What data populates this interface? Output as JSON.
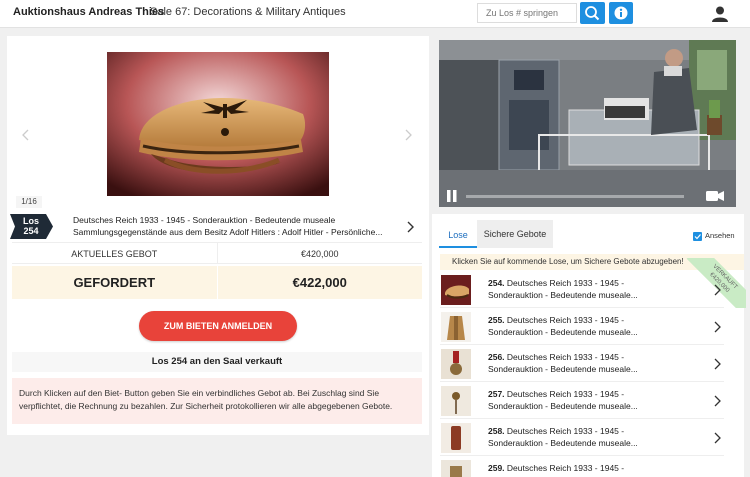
{
  "header": {
    "brand": "Auktionshaus Andreas Thies",
    "sale": "Sale 67: Decorations & Military Antiques",
    "jump_placeholder": "Zu Los # springen"
  },
  "lot": {
    "counter": "1/16",
    "badge_line1": "Los",
    "badge_line2": "254",
    "desc_line1": "Deutsches Reich 1933 - 1945 - Sonderauktion - Bedeutende museale",
    "desc_line2": "Sammlungsgegenstände aus dem Besitz Adolf Hitlers : Adolf Hitler - Persönliche...",
    "current_bid_label": "AKTUELLES GEBOT",
    "current_bid_value": "€420,000",
    "asking_label": "GEFORDERT",
    "asking_value": "€422,000",
    "register_button": "ZUM BIETEN ANMELDEN",
    "sold_status": "Los 254 an den Saal verkauft",
    "notice": "Durch Klicken auf den Biet- Button geben Sie ein verbindliches Gebot ab. Bei Zuschlag sind Sie verpflichtet, die Rechnung zu bezahlen. Zur Sicherheit protokollieren wir alle abgegebenen Gebote."
  },
  "list": {
    "tab_lose": "Lose",
    "tab_sichere": "Sichere Gebote",
    "ansehen": "Ansehen",
    "hint": "Klicken Sie auf kommende Lose, um Sichere Gebote abzugeben!",
    "sold_ribbon_line1": "VERKAUFT",
    "sold_ribbon_line2": "€420,000",
    "items": [
      {
        "num": "254.",
        "title": "Deutsches Reich 1933 - 1945 -",
        "sub": "Sonderauktion - Bedeutende museale..."
      },
      {
        "num": "255.",
        "title": "Deutsches Reich 1933 - 1945 -",
        "sub": "Sonderauktion - Bedeutende museale..."
      },
      {
        "num": "256.",
        "title": "Deutsches Reich 1933 - 1945 -",
        "sub": "Sonderauktion - Bedeutende museale..."
      },
      {
        "num": "257.",
        "title": "Deutsches Reich 1933 - 1945 -",
        "sub": "Sonderauktion - Bedeutende museale..."
      },
      {
        "num": "258.",
        "title": "Deutsches Reich 1933 - 1945 -",
        "sub": "Sonderauktion - Bedeutende museale..."
      },
      {
        "num": "259.",
        "title": "Deutsches Reich 1933 - 1945 -",
        "sub": ""
      }
    ]
  },
  "icons": {
    "search": "search-icon",
    "info": "info-icon",
    "user": "user-icon",
    "pause": "pause-icon",
    "camera": "camera-icon"
  },
  "colors": {
    "accent": "#1e8fe0",
    "register": "#e8433a",
    "highlight": "#fdf5e4",
    "notice": "#fdecea",
    "sold": "#c9ebc5"
  }
}
